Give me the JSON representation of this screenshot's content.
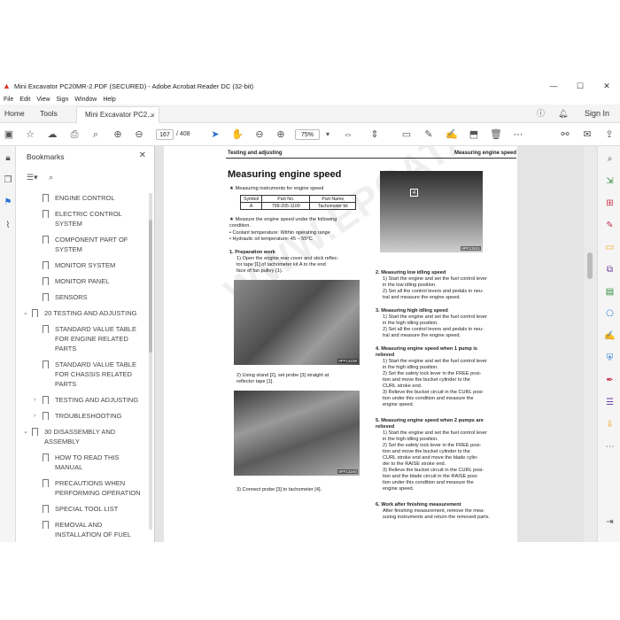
{
  "window": {
    "title": "Mini Excavator PC20MR-2.PDF (SECURED) - Adobe Acrobat Reader DC (32-bit)",
    "minimize": "—",
    "maximize": "☐",
    "close": "✕"
  },
  "menu": [
    "File",
    "Edit",
    "View",
    "Sign",
    "Window",
    "Help"
  ],
  "tabs": {
    "home": "Home",
    "tools": "Tools",
    "document": "Mini Excavator PC2...",
    "close": "×",
    "sign_in": "Sign In"
  },
  "toolbar": {
    "page_current": "167",
    "page_total": "/ 408",
    "zoom": "75%"
  },
  "bookmarks": {
    "title": "Bookmarks",
    "close": "✕",
    "items": [
      {
        "label": "ENGINE CONTROL",
        "level": 2,
        "expand": ""
      },
      {
        "label": "ELECTRIC CONTROL SYSTEM",
        "level": 2,
        "expand": ""
      },
      {
        "label": "COMPONENT PART OF SYSTEM",
        "level": 2,
        "expand": ""
      },
      {
        "label": "MONITOR SYSTEM",
        "level": 2,
        "expand": ""
      },
      {
        "label": "MONITOR PANEL",
        "level": 2,
        "expand": ""
      },
      {
        "label": "SENSORS",
        "level": 2,
        "expand": ""
      },
      {
        "label": "20 TESTING AND ADJUSTING",
        "level": 1,
        "expand": "⌄"
      },
      {
        "label": "STANDARD VALUE TABLE FOR ENGINE RELATED PARTS",
        "level": 2,
        "expand": ""
      },
      {
        "label": "STANDARD VALUE TABLE FOR CHASSIS RELATED PARTS",
        "level": 2,
        "expand": ""
      },
      {
        "label": "TESTING AND ADJUSTING",
        "level": 2,
        "expand": "›"
      },
      {
        "label": "TROUBLESHOOTING",
        "level": 2,
        "expand": "›"
      },
      {
        "label": "30 DISASSEMBLY AND ASSEMBLY",
        "level": 1,
        "expand": "⌄"
      },
      {
        "label": "HOW TO READ THIS MANUAL",
        "level": 2,
        "expand": ""
      },
      {
        "label": "PRECAUTIONS WHEN PERFORMING OPERATION",
        "level": 2,
        "expand": ""
      },
      {
        "label": "SPECIAL TOOL LIST",
        "level": 2,
        "expand": ""
      },
      {
        "label": "REMOVAL AND INSTALLATION OF FUEL INJECTION PUMP ASSEMBLY",
        "level": 2,
        "expand": ""
      }
    ]
  },
  "page": {
    "header_left": "Testing and adjusting",
    "header_right": "Measuring engine speed",
    "heading": "Measuring engine speed",
    "star1": "★  Measuring instruments for engine speed",
    "table": {
      "headers": [
        "Symbol",
        "Part No.",
        "Part Name"
      ],
      "row": [
        "A",
        "799-205-1100",
        "Tachometer kit"
      ]
    },
    "star2a": "★  Measure the engine speed under the following",
    "star2b": "    condition.",
    "cond1": "•  Coolant temperature: Within operating range",
    "cond2": "•  Hydraulic oil temperature: 45 – 55°C",
    "s1_title": "1.  Preparation work",
    "s1_1a": "1)  Open the engine rear cover and stick reflec-",
    "s1_1b": "     tor tape [1] of tachometer kit A to the end",
    "s1_1c": "     face of fan pulley (1).",
    "s1_2a": "2)  Using stand [2], set probe [3] straight at",
    "s1_2b": "     reflector tape [1].",
    "s1_3": "3)  Connect probe [3] to tachometer [4].",
    "photo1_tag": "9PF13238",
    "photo2_tag": "9PF13240",
    "photo3_tag": "9PF13241",
    "photo3_label": "4",
    "s2_title": "2.  Measuring low idling speed",
    "s2_1a": "1)  Start the engine and set the fuel control lever",
    "s2_1b": "     in the low idling position.",
    "s2_2a": "2)  Set all the control levers and pedals in neu-",
    "s2_2b": "     tral and measure the engine speed.",
    "s3_title": "3.  Measuring high idling speed",
    "s3_1a": "1)  Start the engine and set the fuel control lever",
    "s3_1b": "     in the high idling position.",
    "s3_2a": "2)  Set all the control levers and pedals in neu-",
    "s3_2b": "     tral and measure the engine speed.",
    "s4_title_a": "4.  Measuring engine speed when 1 pump is",
    "s4_title_b": "     relieved",
    "s4_1a": "1)  Start the engine and set the fuel control lever",
    "s4_1b": "     in the high idling position.",
    "s4_2a": "2)  Set the safety lock lever in the FREE posi-",
    "s4_2b": "     tion and move the bucket cylinder to the",
    "s4_2c": "     CURL stroke end.",
    "s4_3a": "3)  Relieve the bucket circuit in the CURL posi-",
    "s4_3b": "     tion under this condition and measure the",
    "s4_3c": "     engine speed.",
    "s5_title_a": "5.  Measuring engine speed when 2 pumps are",
    "s5_title_b": "     relieved",
    "s5_1a": "1)  Start the engine and set the fuel control lever",
    "s5_1b": "     in the high idling position.",
    "s5_2a": "2)  Set the safety lock lever in the FREE posi-",
    "s5_2b": "     tion and move the bucket cylinder to the",
    "s5_2c": "     CURL stroke end and move the blade cylin-",
    "s5_2d": "     der to the RAISE stroke end.",
    "s5_3a": "3)  Relieve the bucket circuit in the CURL posi-",
    "s5_3b": "     tion and the blade circuit in the RAISE posi-",
    "s5_3c": "     tion under this condition and measure the",
    "s5_3d": "     engine speed.",
    "s6_title": "6.  Work after finishing measurement",
    "s6_a": "After finishing measurement, remove the mea-",
    "s6_b": "suring instruments and return the removed parts.",
    "watermark": "WWW.EPCATALOGS.COM"
  },
  "icons": {
    "left_rail": [
      "lock-icon",
      "pages-icon",
      "bookmark-icon",
      "attachment-icon"
    ],
    "right_rail_colors": [
      "#555555",
      "#2d8c3c",
      "#c8324b",
      "#c8324b",
      "#e8a317",
      "#6b3fa0",
      "#2d8c3c",
      "#2a7bd3",
      "#c8324b",
      "#2a7bd3",
      "#c8324b",
      "#6b3fa0",
      "#e8a317",
      "#555555"
    ]
  }
}
